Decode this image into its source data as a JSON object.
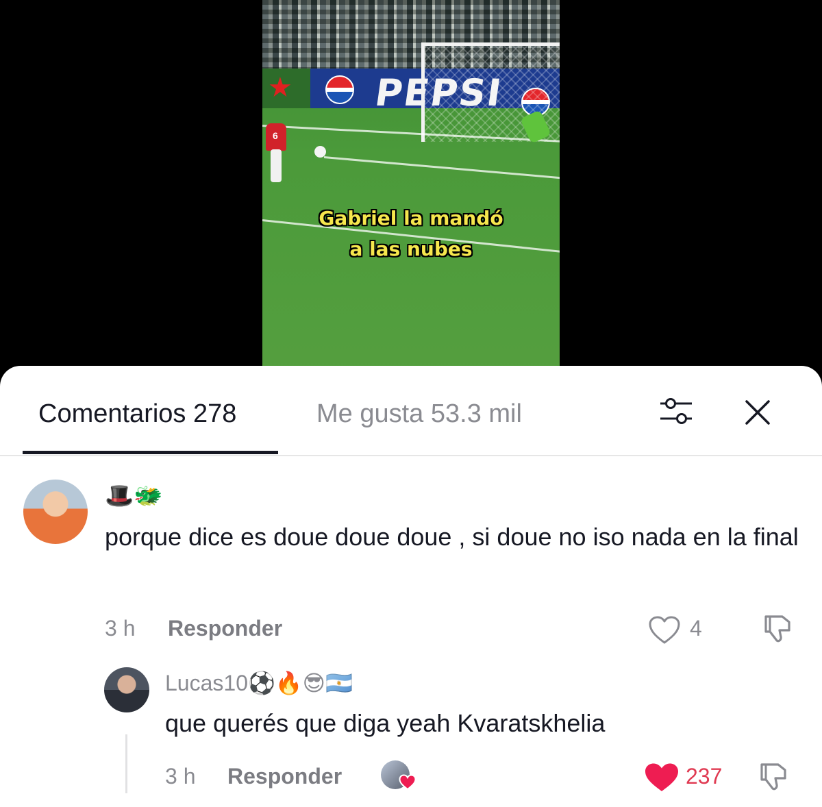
{
  "video": {
    "caption_line1": "Gabriel la mandó",
    "caption_line2": "a las nubes",
    "ad_text": "PEPSI",
    "ad_logo_text": "PEPSI",
    "player_number": "6"
  },
  "tabs": {
    "comments_label": "Comentarios 278",
    "likes_label": "Me gusta 53.3 mil"
  },
  "comments": [
    {
      "username": "🎩🐲",
      "text": "porque dice es doue doue doue , si doue no iso nada en la final",
      "time": "3 h",
      "reply_label": "Responder",
      "like_count": "4",
      "liked": false
    },
    {
      "username": "Lucas10⚽🔥😎🇦🇷",
      "text": "que querés que diga yeah Kvaratskhelia",
      "time": "3 h",
      "reply_label": "Responder",
      "like_count": "237",
      "liked": true
    }
  ],
  "icons": {
    "filter": "filter-sliders-icon",
    "close": "close-icon",
    "like": "heart-icon",
    "dislike": "thumbs-down-icon"
  },
  "colors": {
    "liked_heart": "#ee1d52",
    "caption_yellow": "#f6e74d",
    "muted_text": "#8a8b91"
  }
}
